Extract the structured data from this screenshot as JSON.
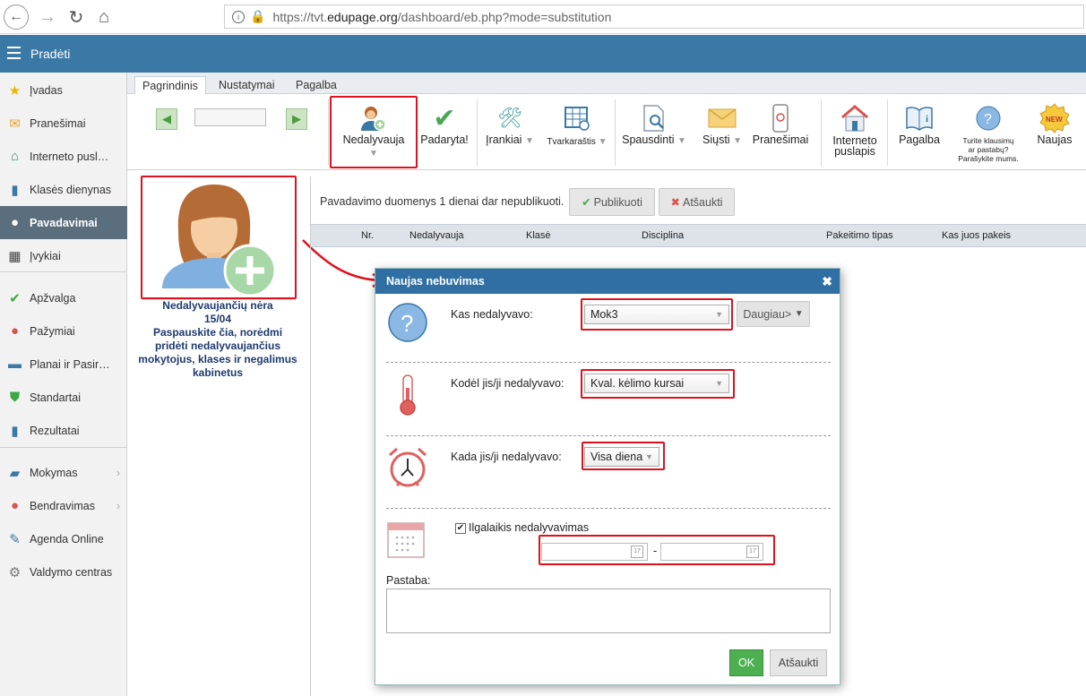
{
  "browser": {
    "url_prefix": "https://tvt.",
    "url_host": "edupage.org",
    "url_path": "/dashboard/eb.php?mode=substitution",
    "back_icon": "arrow-left",
    "forward_icon": "arrow-right",
    "reload_icon": "reload",
    "home_icon": "home",
    "info_icon": "info",
    "lock_icon": "lock"
  },
  "topbar": {
    "title": "Pradėti",
    "color": "#3a78a6"
  },
  "sidebar": {
    "items": [
      {
        "label": "Įvadas",
        "icon": "star-icon",
        "glyph": "★",
        "color": "#f0b400"
      },
      {
        "label": "Pranešimai",
        "icon": "mail-icon",
        "glyph": "✉",
        "color": "#e8a33a"
      },
      {
        "label": "Interneto pusl…",
        "icon": "home-icon",
        "glyph": "⌂",
        "color": "#3a8a6a"
      },
      {
        "label": "Klasės dienynas",
        "icon": "book-icon",
        "glyph": "▮",
        "color": "#3a78a6"
      },
      {
        "label": "Pavadavimai",
        "icon": "person-icon",
        "glyph": "●",
        "color": "#ffffff"
      },
      {
        "label": "Įvykiai",
        "icon": "calendar-icon",
        "glyph": "▦",
        "color": "#444"
      },
      {
        "label": "Apžvalga",
        "icon": "check-circle-icon",
        "glyph": "✔",
        "color": "#3aa845"
      },
      {
        "label": "Pažymiai",
        "icon": "grades-icon",
        "glyph": "●",
        "color": "#d9534f"
      },
      {
        "label": "Planai ir Pasir…",
        "icon": "briefcase-icon",
        "glyph": "▬",
        "color": "#3a78a6"
      },
      {
        "label": "Standartai",
        "icon": "shield-icon",
        "glyph": "⛊",
        "color": "#3aa845"
      },
      {
        "label": "Rezultatai",
        "icon": "bar-chart-icon",
        "glyph": "▮",
        "color": "#3a78a6"
      },
      {
        "label": "Mokymas",
        "icon": "open-book-icon",
        "glyph": "▰",
        "color": "#3a78a6"
      },
      {
        "label": "Bendravimas",
        "icon": "chat-icon",
        "glyph": "●",
        "color": "#d9534f"
      },
      {
        "label": "Agenda Online",
        "icon": "pen-icon",
        "glyph": "✎",
        "color": "#3a78a6"
      },
      {
        "label": "Valdymo centras",
        "icon": "gear-icon",
        "glyph": "⚙",
        "color": "#777"
      }
    ],
    "active_index": 4
  },
  "tabs": [
    "Pagrindinis",
    "Nustatymai",
    "Pagalba"
  ],
  "ribbon": {
    "absent": "Nedalyvauja",
    "done": "Padaryta!",
    "tools": "Įrankiai",
    "timetable": "Tvarkaraštis",
    "print": "Spausdinti",
    "send": "Siųsti",
    "notifications": "Pranešimai",
    "website_line1": "Interneto",
    "website_line2": "puslapis",
    "help": "Pagalba",
    "feedback_line1": "Turite klausimų",
    "feedback_line2": "ar pastabų?",
    "feedback_line3": "Parašykite mums.",
    "new_label": "Naujas",
    "new_badge": "NEW"
  },
  "left_panel": {
    "line1": "Nedalyvaujančių nėra",
    "line2": "15/04",
    "line3": "Paspauskite čia, norėdmi",
    "line4": "pridėti nedalyvaujančius",
    "line5": "mokytojus, klases ir negalimus",
    "line6": "kabinetus"
  },
  "content": {
    "publish_message": "Pavadavimo duomenys 1 dienai dar nepublikuoti.",
    "publish_button": "Publikuoti",
    "cancel_button": "Atšaukti",
    "columns": [
      "Nr.",
      "Nedalyvauja",
      "Klasė",
      "Disciplina",
      "Pakeitimo tipas",
      "Kas juos pakeis"
    ]
  },
  "dialog": {
    "title": "Naujas nebuvimas",
    "who_label": "Kas nedalyvavo:",
    "who_value": "Mok3",
    "more_button": "Daugiau>",
    "why_label": "Kodėl jis/ji nedalyvavo:",
    "why_value": "Kval. kėlimo kursai",
    "when_label": "Kada jis/ji nedalyvavo:",
    "when_value": "Visa diena",
    "longterm_label": "Ilgalaikis nedalyvavimas",
    "longterm_checked": true,
    "date_separator": "-",
    "calendar_day": "17",
    "note_label": "Pastaba:",
    "note_value": "",
    "ok_button": "OK",
    "cancel_button": "Atšaukti"
  }
}
